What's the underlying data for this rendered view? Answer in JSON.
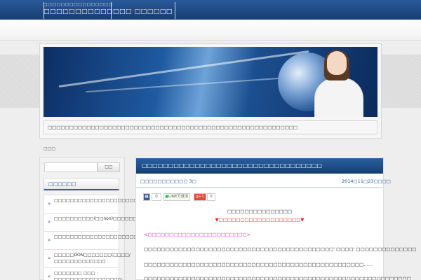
{
  "header": {
    "tagline": "□□□□□□□□□□□□□□□□",
    "site_title": "□□□□□□□□□□□□□□ □□□□□□"
  },
  "nav": {
    "items": [
      {
        "label": "□□□□□□"
      },
      {
        "label": "□□□□□□□□"
      }
    ]
  },
  "hero": {
    "caption": "□□□□□□□□□□□□□□□□□□□□□□□□□□□□□□□□□□□□□□□□□□□□□□□□□□□□□□□□□□"
  },
  "breadcrumb": {
    "text": "□□□"
  },
  "sidebar": {
    "search_placeholder": "",
    "search_button": "□□",
    "heading": "□□□□□□",
    "items": [
      {
        "label": "□□□□□□□□□□□□□□□□□□□□□□□□□□□□"
      },
      {
        "label": "□□□□□□□□□□(□□non)□□□□□□□□□□□□□□□□□"
      },
      {
        "label": "□□□□□□□□□□□□□□□□□□□□□□□□□□□□□□□□□"
      },
      {
        "label": "□□□□□DON□□□□□□□(□□□□/□□□□□□□□□□□□□"
      },
      {
        "label": "□□□□□□□ □□□ : □□□□□□□□□□□□□□□□□"
      }
    ]
  },
  "post": {
    "title": "□□□□□□□□□□□□□□□□□□□□□□□□□□□□□□□□□□",
    "category": "□□□□□□□□□□□ 3□",
    "date": "2014□11□23□□□□",
    "share": {
      "count_1": "0",
      "line_label": "LINEで送る",
      "gplus_label": "g+1",
      "count_2": "0"
    },
    "center_line_1": "□□□□□□□□□□□□□□□",
    "center_line_2": "▼□□□□□□□□□□□□□□□□□□□▼",
    "magenta_line": "<□□□□□□□□□□□□□□□□□□□□□□□>",
    "paragraph_1": "□□□□□□□□□□□□□□□□□□□□□□□□□□□□□□□□□□□□□□□□□□□□' □□□□' □□□□□□□□□□□□□□",
    "paragraph_2": "□□□□□□□□□□□□□□□□□□□□□□□□□□□□□□□□□□□□□□□□□□□□□□□□□□□……",
    "paragraph_3": "□□□□□□□□□□□□□□□□□□□□□□□□□□□□□□□□□□□□□□□□□□□□□□□□□□□□□□□□□□□□□□"
  },
  "colors": {
    "header_blue": "#1f4c86",
    "accent_red": "#e21d1d",
    "accent_magenta": "#e61ed1",
    "link_blue": "#1e4d8c"
  }
}
